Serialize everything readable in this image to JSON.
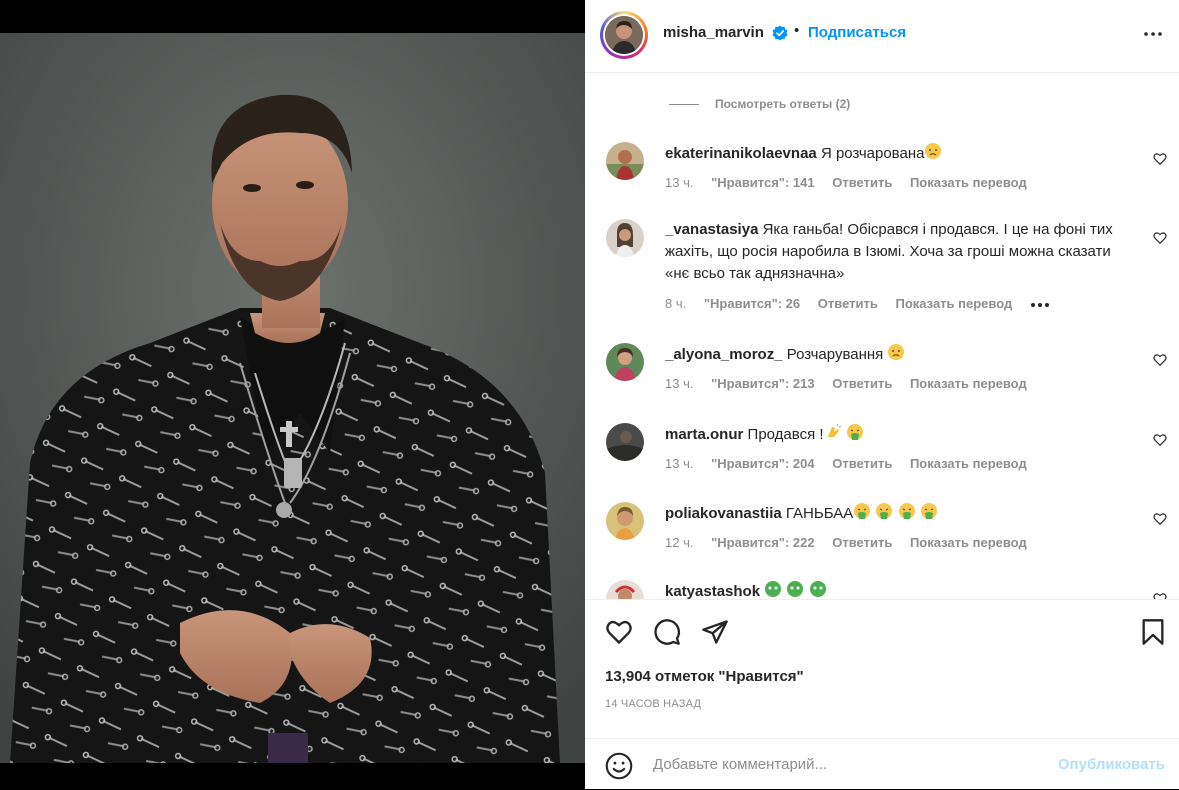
{
  "post": {
    "username": "misha_marvin",
    "follow_label": "Подписаться",
    "separator": "•",
    "view_replies": "Посмотреть ответы (2)",
    "likes_text": "13,904 отметок \"Нравится\"",
    "time_ago": "14 ЧАСОВ НАЗАД",
    "comment_placeholder": "Добавьте комментарий...",
    "publish_label": "Опубликовать"
  },
  "comments": [
    {
      "user": "ekaterinanikolaevnaa",
      "text": "Я розчарована",
      "emoji": "disappointed-face",
      "time": "13 ч.",
      "likes": "\"Нравится\": 141",
      "reply": "Ответить",
      "translate": "Показать перевод"
    },
    {
      "user": "_vanastasiya",
      "text": "Яка ганьба! Обісрався і продався. І це на фоні тих жахіть, що росія наробила в Ізюмі. Хоча за гроші можна сказати «нє всьо так аднязначна»",
      "time": "8 ч.",
      "likes": "\"Нравится\": 26",
      "reply": "Ответить",
      "translate": "Показать перевод",
      "has_more": true
    },
    {
      "user": "_alyona_moroz_",
      "text": "Розчарування",
      "emoji": "disappointed-face",
      "time": "13 ч.",
      "likes": "\"Нравится\": 213",
      "reply": "Ответить",
      "translate": "Показать перевод"
    },
    {
      "user": "marta.onur",
      "text": "Продався !",
      "emoji": "clap-and-vomit",
      "time": "13 ч.",
      "likes": "\"Нравится\": 204",
      "reply": "Ответить",
      "translate": "Показать перевод"
    },
    {
      "user": "poliakovanastiia",
      "text": "ГАНЬБАА",
      "emoji": "vomit-face-x4",
      "time": "12 ч.",
      "likes": "\"Нравится\": 222",
      "reply": "Ответить",
      "translate": "Показать перевод"
    },
    {
      "user": "katyastashok",
      "text": "",
      "emoji": "nauseated-face-x3"
    }
  ],
  "colors": {
    "accent": "#0095f6",
    "publish_disabled": "#b2dffc",
    "meta": "#8e8e8e"
  },
  "icons": [
    "verified-badge-icon",
    "more-options-icon",
    "heart-icon",
    "comment-icon",
    "share-icon",
    "bookmark-icon",
    "emoji-icon"
  ]
}
